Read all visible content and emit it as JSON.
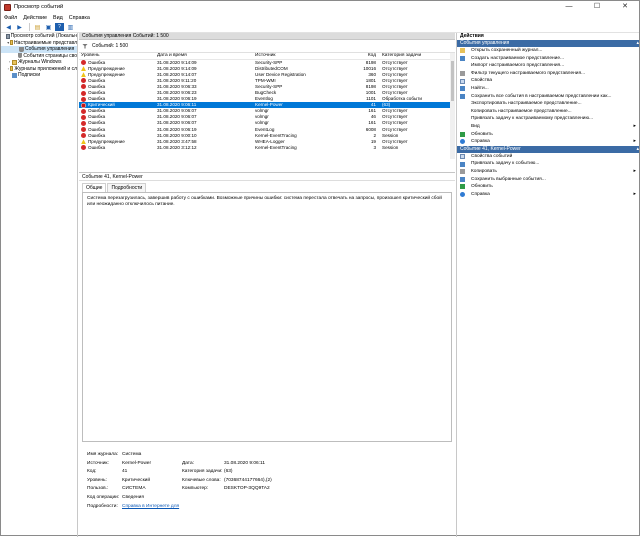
{
  "window": {
    "title": "Просмотр событий",
    "controls": [
      "—",
      "☐",
      "✕"
    ]
  },
  "menu": [
    "Файл",
    "Действие",
    "Вид",
    "Справка"
  ],
  "tree": [
    {
      "label": "Просмотр событий (Локальн",
      "twisty": "",
      "icon": "root"
    },
    {
      "label": "Настраиваемые представл",
      "twisty": "▾",
      "icon": "folder"
    },
    {
      "label": "События управления",
      "twisty": "",
      "icon": "filter",
      "selected": true
    },
    {
      "label": "События страницы сво",
      "twisty": "",
      "icon": "filter"
    },
    {
      "label": "Журналы Windows",
      "twisty": "›",
      "icon": "folder"
    },
    {
      "label": "Журналы приложений и сл",
      "twisty": "›",
      "icon": "folder"
    },
    {
      "label": "Подписки",
      "twisty": "",
      "icon": "list"
    }
  ],
  "center": {
    "header": "События управления   Событий: 1 500",
    "filter_text": "Событий: 1 500",
    "columns": [
      "Уровень",
      "Дата и время",
      "Источник",
      "Код события",
      "Категория задачи"
    ],
    "rows": [
      [
        "Ошибка",
        "31.08.2020 9:14:09",
        "Security-SPP",
        "8198",
        "Отсутствует",
        "err"
      ],
      [
        "Предупреждение",
        "31.08.2020 9:14:09",
        "DistributedCOM",
        "10016",
        "Отсутствует",
        "warn"
      ],
      [
        "Предупреждение",
        "31.08.2020 9:14:07",
        "User Device Registration",
        "360",
        "Отсутствует",
        "warn"
      ],
      [
        "Ошибка",
        "31.08.2020 9:11:20",
        "TPM-WMI",
        "1801",
        "Отсутствует",
        "err"
      ],
      [
        "Ошибка",
        "31.08.2020 9:06:33",
        "Security-SPP",
        "8198",
        "Отсутствует",
        "err"
      ],
      [
        "Ошибка",
        "31.08.2020 9:06:23",
        "BugCheck",
        "1001",
        "Отсутствует",
        "err"
      ],
      [
        "Ошибка",
        "31.08.2020 9:06:19",
        "Eventlog",
        "1101",
        "Обработка событи",
        "err"
      ],
      [
        "Критический",
        "31.08.2020 9:06:11",
        "Kernel-Power",
        "41",
        "(63)",
        "crit"
      ],
      [
        "Ошибка",
        "31.08.2020 9:06:07",
        "volmgr",
        "161",
        "Отсутствует",
        "err"
      ],
      [
        "Ошибка",
        "31.08.2020 9:06:07",
        "volmgr",
        "46",
        "Отсутствует",
        "err"
      ],
      [
        "Ошибка",
        "31.08.2020 9:06:07",
        "volmgr",
        "161",
        "Отсутствует",
        "err"
      ],
      [
        "Ошибка",
        "31.08.2020 9:06:19",
        "EventLog",
        "6008",
        "Отсутствует",
        "err"
      ],
      [
        "Ошибка",
        "31.08.2020 9:00:10",
        "Kernel-EventTracing",
        "2",
        "Session",
        "err"
      ],
      [
        "Предупреждение",
        "31.08.2020 3:47:58",
        "WHEA-Logger",
        "19",
        "Отсутствует",
        "warn"
      ],
      [
        "Ошибка",
        "31.08.2020 3:12:12",
        "Kernel-EventTracing",
        "3",
        "Session",
        "err"
      ]
    ],
    "selected_row": 7
  },
  "detail": {
    "header": "Событие 41, Kernel-Power",
    "tabs": [
      "Общие",
      "Подробности"
    ],
    "description": "Система перезагрузилась, завершив работу с ошибками. Возможные причины ошибки: система перестала отвечать на запросы, произошел критический сбой или неожиданно отключилось питание.",
    "props": {
      "log_label": "Имя журнала:",
      "log_value": "Система",
      "source_label": "Источник:",
      "source_value": "Kernel-Power",
      "date_label": "Дата:",
      "date_value": "31.08.2020 9:06:11",
      "code_label": "Код:",
      "code_value": "41",
      "task_label": "Категория задачи:",
      "task_value": "(63)",
      "level_label": "Уровень:",
      "level_value": "Критический",
      "keywords_label": "Ключевые слова:",
      "keywords_value": "(70368744177664),(2)",
      "user_label": "Пользов.:",
      "user_value": "СИСТЕМА",
      "computer_label": "Компьютер:",
      "computer_value": "DESKTOP-3QQ9TA2",
      "opcode_label": "Код операции:",
      "opcode_value": "Сведения",
      "more_label": "Подробности:",
      "more_value": "Справка в Интернете для"
    }
  },
  "actions": {
    "title": "Действия",
    "section1": "События управления",
    "items1": [
      {
        "label": "Открыть сохраненный журнал...",
        "icon": "folder"
      },
      {
        "label": "Создать настраиваемое представление...",
        "icon": "blue"
      },
      {
        "label": "Импорт настраиваемого представления...",
        "icon": "none"
      },
      {
        "label": "Фильтр текущего настраиваемого представления...",
        "icon": "grey"
      },
      {
        "label": "Свойства",
        "icon": "prop"
      },
      {
        "label": "Найти...",
        "icon": "blue"
      },
      {
        "label": "Сохранить все события в настраиваемом представлении как...",
        "icon": "blue"
      },
      {
        "label": "Экспортировать настраиваемое представление...",
        "icon": "none"
      },
      {
        "label": "Копировать настраиваемое представление...",
        "icon": "none"
      },
      {
        "label": "Привязать задачу к настраиваемому представлению...",
        "icon": "none"
      },
      {
        "label": "Вид",
        "icon": "none",
        "arrow": "▸"
      },
      {
        "label": "Обновить",
        "icon": "green"
      },
      {
        "label": "Справка",
        "icon": "help",
        "arrow": "▸"
      }
    ],
    "section2": "Событие 41, Kernel-Power",
    "items2": [
      {
        "label": "Свойства событий",
        "icon": "prop"
      },
      {
        "label": "Привязать задачу к событию...",
        "icon": "blue"
      },
      {
        "label": "Копировать",
        "icon": "grey",
        "arrow": "▸"
      },
      {
        "label": "Сохранить выбранные события...",
        "icon": "blue"
      },
      {
        "label": "Обновить",
        "icon": "green"
      },
      {
        "label": "Справка",
        "icon": "help",
        "arrow": "▸"
      }
    ]
  }
}
